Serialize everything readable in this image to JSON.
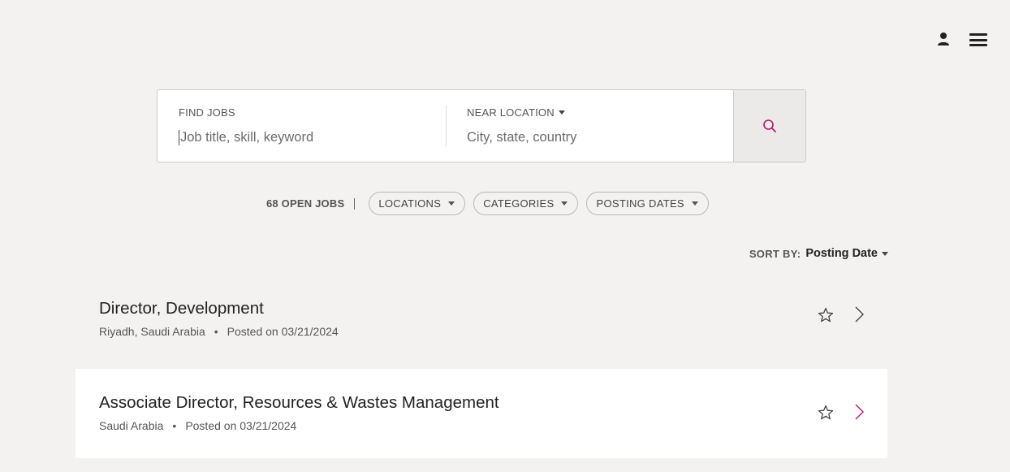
{
  "search": {
    "find_label": "FIND JOBS",
    "find_placeholder": "Job title, skill, keyword",
    "near_label": "NEAR LOCATION",
    "near_placeholder": "City, state, country"
  },
  "filters": {
    "open_jobs": "68 OPEN JOBS",
    "locations": "LOCATIONS",
    "categories": "CATEGORIES",
    "posting_dates": "POSTING DATES"
  },
  "sort": {
    "label": "SORT BY:",
    "value": "Posting Date"
  },
  "jobs": [
    {
      "title": "Director, Development",
      "location": "Riyadh, Saudi Arabia",
      "posted": "Posted on 03/21/2024"
    },
    {
      "title": "Associate Director, Resources & Wastes Management",
      "location": "Saudi Arabia",
      "posted": "Posted on 03/21/2024"
    }
  ],
  "colors": {
    "accent": "#b5176e",
    "background": "#f3f2f0"
  }
}
